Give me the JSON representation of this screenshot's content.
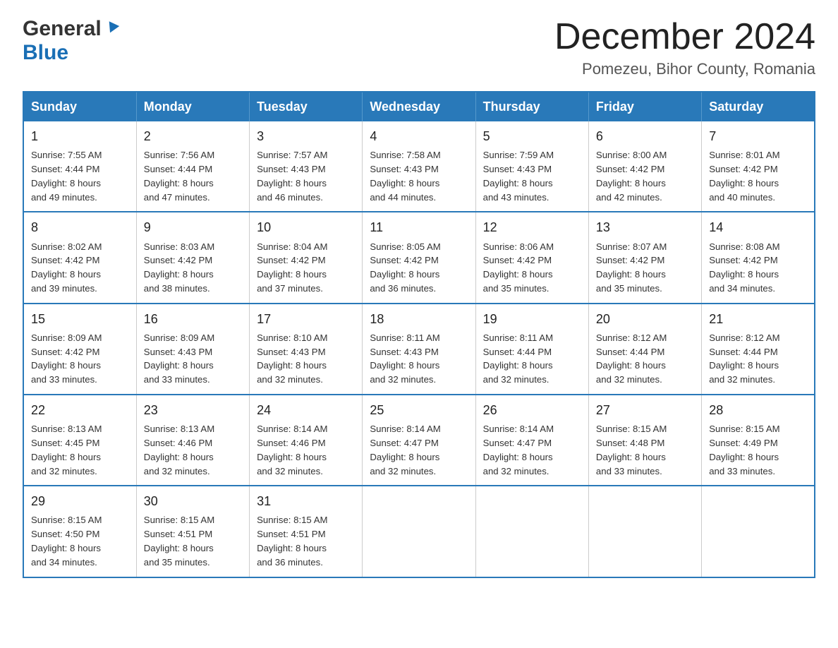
{
  "header": {
    "logo_general": "General",
    "logo_blue": "Blue",
    "month_title": "December 2024",
    "location": "Pomezeu, Bihor County, Romania"
  },
  "calendar": {
    "days_of_week": [
      "Sunday",
      "Monday",
      "Tuesday",
      "Wednesday",
      "Thursday",
      "Friday",
      "Saturday"
    ],
    "weeks": [
      [
        {
          "day": "1",
          "sunrise": "7:55 AM",
          "sunset": "4:44 PM",
          "daylight": "8 hours and 49 minutes."
        },
        {
          "day": "2",
          "sunrise": "7:56 AM",
          "sunset": "4:44 PM",
          "daylight": "8 hours and 47 minutes."
        },
        {
          "day": "3",
          "sunrise": "7:57 AM",
          "sunset": "4:43 PM",
          "daylight": "8 hours and 46 minutes."
        },
        {
          "day": "4",
          "sunrise": "7:58 AM",
          "sunset": "4:43 PM",
          "daylight": "8 hours and 44 minutes."
        },
        {
          "day": "5",
          "sunrise": "7:59 AM",
          "sunset": "4:43 PM",
          "daylight": "8 hours and 43 minutes."
        },
        {
          "day": "6",
          "sunrise": "8:00 AM",
          "sunset": "4:42 PM",
          "daylight": "8 hours and 42 minutes."
        },
        {
          "day": "7",
          "sunrise": "8:01 AM",
          "sunset": "4:42 PM",
          "daylight": "8 hours and 40 minutes."
        }
      ],
      [
        {
          "day": "8",
          "sunrise": "8:02 AM",
          "sunset": "4:42 PM",
          "daylight": "8 hours and 39 minutes."
        },
        {
          "day": "9",
          "sunrise": "8:03 AM",
          "sunset": "4:42 PM",
          "daylight": "8 hours and 38 minutes."
        },
        {
          "day": "10",
          "sunrise": "8:04 AM",
          "sunset": "4:42 PM",
          "daylight": "8 hours and 37 minutes."
        },
        {
          "day": "11",
          "sunrise": "8:05 AM",
          "sunset": "4:42 PM",
          "daylight": "8 hours and 36 minutes."
        },
        {
          "day": "12",
          "sunrise": "8:06 AM",
          "sunset": "4:42 PM",
          "daylight": "8 hours and 35 minutes."
        },
        {
          "day": "13",
          "sunrise": "8:07 AM",
          "sunset": "4:42 PM",
          "daylight": "8 hours and 35 minutes."
        },
        {
          "day": "14",
          "sunrise": "8:08 AM",
          "sunset": "4:42 PM",
          "daylight": "8 hours and 34 minutes."
        }
      ],
      [
        {
          "day": "15",
          "sunrise": "8:09 AM",
          "sunset": "4:42 PM",
          "daylight": "8 hours and 33 minutes."
        },
        {
          "day": "16",
          "sunrise": "8:09 AM",
          "sunset": "4:43 PM",
          "daylight": "8 hours and 33 minutes."
        },
        {
          "day": "17",
          "sunrise": "8:10 AM",
          "sunset": "4:43 PM",
          "daylight": "8 hours and 32 minutes."
        },
        {
          "day": "18",
          "sunrise": "8:11 AM",
          "sunset": "4:43 PM",
          "daylight": "8 hours and 32 minutes."
        },
        {
          "day": "19",
          "sunrise": "8:11 AM",
          "sunset": "4:44 PM",
          "daylight": "8 hours and 32 minutes."
        },
        {
          "day": "20",
          "sunrise": "8:12 AM",
          "sunset": "4:44 PM",
          "daylight": "8 hours and 32 minutes."
        },
        {
          "day": "21",
          "sunrise": "8:12 AM",
          "sunset": "4:44 PM",
          "daylight": "8 hours and 32 minutes."
        }
      ],
      [
        {
          "day": "22",
          "sunrise": "8:13 AM",
          "sunset": "4:45 PM",
          "daylight": "8 hours and 32 minutes."
        },
        {
          "day": "23",
          "sunrise": "8:13 AM",
          "sunset": "4:46 PM",
          "daylight": "8 hours and 32 minutes."
        },
        {
          "day": "24",
          "sunrise": "8:14 AM",
          "sunset": "4:46 PM",
          "daylight": "8 hours and 32 minutes."
        },
        {
          "day": "25",
          "sunrise": "8:14 AM",
          "sunset": "4:47 PM",
          "daylight": "8 hours and 32 minutes."
        },
        {
          "day": "26",
          "sunrise": "8:14 AM",
          "sunset": "4:47 PM",
          "daylight": "8 hours and 32 minutes."
        },
        {
          "day": "27",
          "sunrise": "8:15 AM",
          "sunset": "4:48 PM",
          "daylight": "8 hours and 33 minutes."
        },
        {
          "day": "28",
          "sunrise": "8:15 AM",
          "sunset": "4:49 PM",
          "daylight": "8 hours and 33 minutes."
        }
      ],
      [
        {
          "day": "29",
          "sunrise": "8:15 AM",
          "sunset": "4:50 PM",
          "daylight": "8 hours and 34 minutes."
        },
        {
          "day": "30",
          "sunrise": "8:15 AM",
          "sunset": "4:51 PM",
          "daylight": "8 hours and 35 minutes."
        },
        {
          "day": "31",
          "sunrise": "8:15 AM",
          "sunset": "4:51 PM",
          "daylight": "8 hours and 36 minutes."
        },
        null,
        null,
        null,
        null
      ]
    ]
  },
  "labels": {
    "sunrise_prefix": "Sunrise: ",
    "sunset_prefix": "Sunset: ",
    "daylight_prefix": "Daylight: "
  }
}
